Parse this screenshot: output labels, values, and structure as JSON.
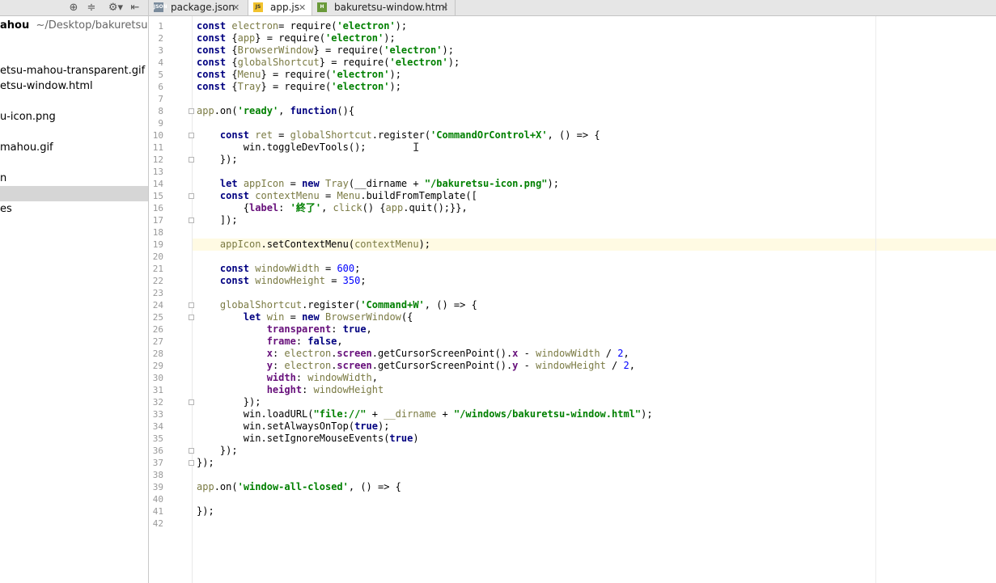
{
  "left_panel": {
    "toolbar_icons": [
      "target-icon",
      "collapse-icon",
      "gear-icon",
      "hide-icon"
    ],
    "root": {
      "name": "ahou",
      "path": "~/Desktop/bakuretsu-m"
    },
    "items": [
      {
        "label": "etsu-mahou-transparent.gif"
      },
      {
        "label": "etsu-window.html"
      },
      {
        "label": "u-icon.png"
      },
      {
        "label": "mahou.gif"
      },
      {
        "label": "n"
      },
      {
        "label": ""
      },
      {
        "label": "es"
      }
    ]
  },
  "tabs": [
    {
      "label": "package.json",
      "icon": "json-file-icon",
      "active": false
    },
    {
      "label": "app.js",
      "icon": "js-file-icon",
      "active": true
    },
    {
      "label": "bakuretsu-window.html",
      "icon": "html-file-icon",
      "active": false
    }
  ],
  "editor": {
    "current_line": 19,
    "line_numbers": [
      "1",
      "2",
      "3",
      "4",
      "5",
      "6",
      "7",
      "8",
      "9",
      "10",
      "11",
      "12",
      "13",
      "14",
      "15",
      "16",
      "17",
      "18",
      "19",
      "20",
      "21",
      "22",
      "23",
      "24",
      "25",
      "26",
      "27",
      "28",
      "29",
      "30",
      "31",
      "32",
      "33",
      "34",
      "35",
      "36",
      "37",
      "38",
      "39",
      "40",
      "41",
      "42"
    ],
    "lines": [
      [
        [
          "kw",
          "const "
        ],
        [
          "gbl",
          "electron"
        ],
        [
          "",
          "= "
        ],
        [
          "fn",
          "require"
        ],
        [
          "",
          "("
        ],
        [
          "str",
          "'electron'"
        ],
        [
          "",
          ");"
        ]
      ],
      [
        [
          "kw",
          "const "
        ],
        [
          "",
          "{"
        ],
        [
          "gbl",
          "app"
        ],
        [
          "",
          "} = "
        ],
        [
          "fn",
          "require"
        ],
        [
          "",
          "("
        ],
        [
          "str",
          "'electron'"
        ],
        [
          "",
          ");"
        ]
      ],
      [
        [
          "kw",
          "const "
        ],
        [
          "",
          "{"
        ],
        [
          "gbl",
          "BrowserWindow"
        ],
        [
          "",
          "} = "
        ],
        [
          "fn",
          "require"
        ],
        [
          "",
          "("
        ],
        [
          "str",
          "'electron'"
        ],
        [
          "",
          ");"
        ]
      ],
      [
        [
          "kw",
          "const "
        ],
        [
          "",
          "{"
        ],
        [
          "gbl",
          "globalShortcut"
        ],
        [
          "",
          "} = "
        ],
        [
          "fn",
          "require"
        ],
        [
          "",
          "("
        ],
        [
          "str",
          "'electron'"
        ],
        [
          "",
          ");"
        ]
      ],
      [
        [
          "kw",
          "const "
        ],
        [
          "",
          "{"
        ],
        [
          "gbl",
          "Menu"
        ],
        [
          "",
          "} = "
        ],
        [
          "fn",
          "require"
        ],
        [
          "",
          "("
        ],
        [
          "str",
          "'electron'"
        ],
        [
          "",
          ");"
        ]
      ],
      [
        [
          "kw",
          "const "
        ],
        [
          "",
          "{"
        ],
        [
          "gbl",
          "Tray"
        ],
        [
          "",
          "} = "
        ],
        [
          "fn",
          "require"
        ],
        [
          "",
          "("
        ],
        [
          "str",
          "'electron'"
        ],
        [
          "",
          ");"
        ]
      ],
      [],
      [
        [
          "gbl",
          "app"
        ],
        [
          "",
          ".on("
        ],
        [
          "str",
          "'ready'"
        ],
        [
          "",
          ", "
        ],
        [
          "kw",
          "function"
        ],
        [
          "",
          "(){"
        ]
      ],
      [],
      [
        [
          "",
          "    "
        ],
        [
          "kw",
          "const "
        ],
        [
          "gbl",
          "ret"
        ],
        [
          "",
          " = "
        ],
        [
          "gbl",
          "globalShortcut"
        ],
        [
          "",
          ".register("
        ],
        [
          "str",
          "'CommandOrControl+X'"
        ],
        [
          "",
          ", () => {"
        ]
      ],
      [
        [
          "",
          "        win.toggleDevTools();"
        ]
      ],
      [
        [
          "",
          "    });"
        ]
      ],
      [],
      [
        [
          "",
          "    "
        ],
        [
          "kw",
          "let "
        ],
        [
          "gbl",
          "appIcon"
        ],
        [
          "",
          " = "
        ],
        [
          "kw",
          "new "
        ],
        [
          "gbl",
          "Tray"
        ],
        [
          "",
          "(__dirname + "
        ],
        [
          "str",
          "\"/bakuretsu-icon.png\""
        ],
        [
          "",
          ");"
        ]
      ],
      [
        [
          "",
          "    "
        ],
        [
          "kw",
          "const "
        ],
        [
          "gbl",
          "contextMenu"
        ],
        [
          "",
          " = "
        ],
        [
          "gbl",
          "Menu"
        ],
        [
          "",
          ".buildFromTemplate(["
        ]
      ],
      [
        [
          "",
          "        {"
        ],
        [
          "prop",
          "label"
        ],
        [
          "",
          ": "
        ],
        [
          "str",
          "'終了'"
        ],
        [
          "",
          ", "
        ],
        [
          "gbl",
          "click"
        ],
        [
          "",
          "() {"
        ],
        [
          "gbl",
          "app"
        ],
        [
          "",
          ".quit();}},"
        ]
      ],
      [
        [
          "",
          "    ]);"
        ]
      ],
      [],
      [
        [
          "",
          "    "
        ],
        [
          "gbl",
          "appIcon"
        ],
        [
          "",
          ".setContextMenu("
        ],
        [
          "gbl",
          "contextMenu"
        ],
        [
          "",
          ");"
        ]
      ],
      [],
      [
        [
          "",
          "    "
        ],
        [
          "kw",
          "const "
        ],
        [
          "gbl",
          "windowWidth"
        ],
        [
          "",
          " = "
        ],
        [
          "num",
          "600"
        ],
        [
          "",
          ";"
        ]
      ],
      [
        [
          "",
          "    "
        ],
        [
          "kw",
          "const "
        ],
        [
          "gbl",
          "windowHeight"
        ],
        [
          "",
          " = "
        ],
        [
          "num",
          "350"
        ],
        [
          "",
          ";"
        ]
      ],
      [],
      [
        [
          "",
          "    "
        ],
        [
          "gbl",
          "globalShortcut"
        ],
        [
          "",
          ".register("
        ],
        [
          "str",
          "'Command+W'"
        ],
        [
          "",
          ", () => {"
        ]
      ],
      [
        [
          "",
          "        "
        ],
        [
          "kw",
          "let "
        ],
        [
          "gbl",
          "win"
        ],
        [
          "",
          " = "
        ],
        [
          "kw",
          "new "
        ],
        [
          "gbl",
          "BrowserWindow"
        ],
        [
          "",
          "({"
        ]
      ],
      [
        [
          "",
          "            "
        ],
        [
          "prop",
          "transparent"
        ],
        [
          "",
          ": "
        ],
        [
          "kw",
          "true"
        ],
        [
          "",
          ","
        ]
      ],
      [
        [
          "",
          "            "
        ],
        [
          "prop",
          "frame"
        ],
        [
          "",
          ": "
        ],
        [
          "kw",
          "false"
        ],
        [
          "",
          ","
        ]
      ],
      [
        [
          "",
          "            "
        ],
        [
          "prop",
          "x"
        ],
        [
          "",
          ": "
        ],
        [
          "gbl",
          "electron"
        ],
        [
          "",
          "."
        ],
        [
          "prop",
          "screen"
        ],
        [
          "",
          ".getCursorScreenPoint()."
        ],
        [
          "prop",
          "x"
        ],
        [
          "",
          " - "
        ],
        [
          "gbl",
          "windowWidth"
        ],
        [
          "",
          " / "
        ],
        [
          "num",
          "2"
        ],
        [
          "",
          ","
        ]
      ],
      [
        [
          "",
          "            "
        ],
        [
          "prop",
          "y"
        ],
        [
          "",
          ": "
        ],
        [
          "gbl",
          "electron"
        ],
        [
          "",
          "."
        ],
        [
          "prop",
          "screen"
        ],
        [
          "",
          ".getCursorScreenPoint()."
        ],
        [
          "prop",
          "y"
        ],
        [
          "",
          " - "
        ],
        [
          "gbl",
          "windowHeight"
        ],
        [
          "",
          " / "
        ],
        [
          "num",
          "2"
        ],
        [
          "",
          ","
        ]
      ],
      [
        [
          "",
          "            "
        ],
        [
          "prop",
          "width"
        ],
        [
          "",
          ": "
        ],
        [
          "gbl",
          "windowWidth"
        ],
        [
          "",
          ","
        ]
      ],
      [
        [
          "",
          "            "
        ],
        [
          "prop",
          "height"
        ],
        [
          "",
          ": "
        ],
        [
          "gbl",
          "windowHeight"
        ]
      ],
      [
        [
          "",
          "        });"
        ]
      ],
      [
        [
          "",
          "        win.loadURL("
        ],
        [
          "str",
          "\"file://\""
        ],
        [
          "",
          " + "
        ],
        [
          "gbl",
          "__dirname"
        ],
        [
          "",
          " + "
        ],
        [
          "str",
          "\"/windows/bakuretsu-window.html\""
        ],
        [
          "",
          ");"
        ]
      ],
      [
        [
          "",
          "        win.setAlwaysOnTop("
        ],
        [
          "kw",
          "true"
        ],
        [
          "",
          ");"
        ]
      ],
      [
        [
          "",
          "        win.setIgnoreMouseEvents("
        ],
        [
          "kw",
          "true"
        ],
        [
          "",
          ")"
        ]
      ],
      [
        [
          "",
          "    });"
        ]
      ],
      [
        [
          "",
          "});"
        ]
      ],
      [],
      [
        [
          "gbl",
          "app"
        ],
        [
          "",
          ".on("
        ],
        [
          "str",
          "'window-all-closed'"
        ],
        [
          "",
          ", () => {"
        ]
      ],
      [],
      [
        [
          "",
          "});"
        ]
      ],
      []
    ]
  },
  "colors": {
    "keyword": "#000080",
    "string": "#008000",
    "number": "#0000ff",
    "caret_line": "#fffae3"
  }
}
